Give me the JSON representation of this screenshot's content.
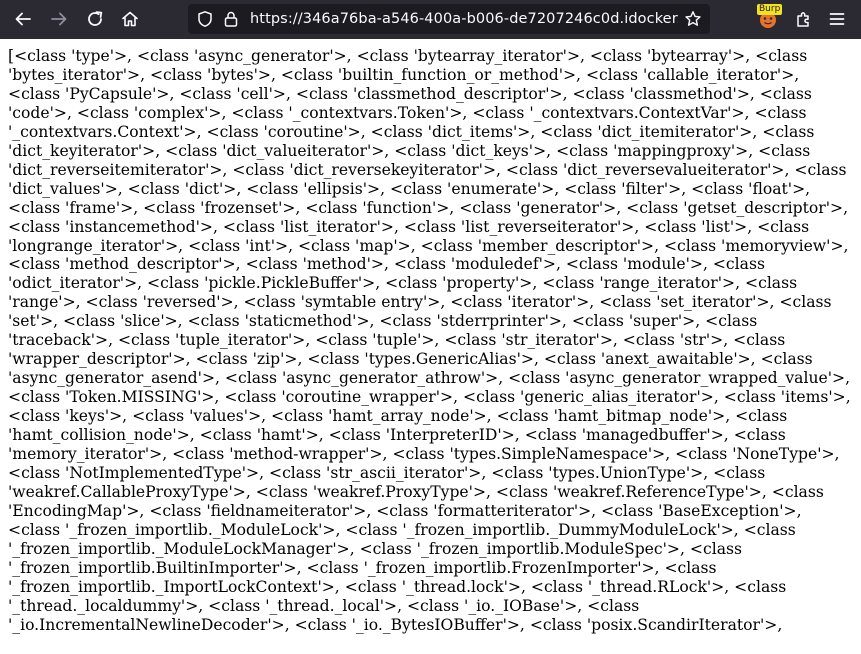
{
  "browser": {
    "url": "https://346a76ba-a546-400a-b006-de7207246c0d.idocker.vulnhub.cn",
    "extension_badge": "Burp"
  },
  "icons": {
    "back": "arrow-left-icon",
    "forward": "arrow-right-icon",
    "reload": "reload-icon",
    "home": "home-icon",
    "tracking_protection": "shield-icon",
    "connection": "lock-icon",
    "bookmark": "star-icon",
    "burp_extension": "burp-extension-icon",
    "extensions": "puzzle-icon",
    "menu": "hamburger-menu-icon"
  },
  "page": {
    "body_text": "[<class 'type'>, <class 'async_generator'>, <class 'bytearray_iterator'>, <class 'bytearray'>, <class 'bytes_iterator'>, <class 'bytes'>, <class 'builtin_function_or_method'>, <class 'callable_iterator'>, <class 'PyCapsule'>, <class 'cell'>, <class 'classmethod_descriptor'>, <class 'classmethod'>, <class 'code'>, <class 'complex'>, <class '_contextvars.Token'>, <class '_contextvars.ContextVar'>, <class '_contextvars.Context'>, <class 'coroutine'>, <class 'dict_items'>, <class 'dict_itemiterator'>, <class 'dict_keyiterator'>, <class 'dict_valueiterator'>, <class 'dict_keys'>, <class 'mappingproxy'>, <class 'dict_reverseitemiterator'>, <class 'dict_reversekeyiterator'>, <class 'dict_reversevalueiterator'>, <class 'dict_values'>, <class 'dict'>, <class 'ellipsis'>, <class 'enumerate'>, <class 'filter'>, <class 'float'>, <class 'frame'>, <class 'frozenset'>, <class 'function'>, <class 'generator'>, <class 'getset_descriptor'>, <class 'instancemethod'>, <class 'list_iterator'>, <class 'list_reverseiterator'>, <class 'list'>, <class 'longrange_iterator'>, <class 'int'>, <class 'map'>, <class 'member_descriptor'>, <class 'memoryview'>, <class 'method_descriptor'>, <class 'method'>, <class 'moduledef'>, <class 'module'>, <class 'odict_iterator'>, <class 'pickle.PickleBuffer'>, <class 'property'>, <class 'range_iterator'>, <class 'range'>, <class 'reversed'>, <class 'symtable entry'>, <class 'iterator'>, <class 'set_iterator'>, <class 'set'>, <class 'slice'>, <class 'staticmethod'>, <class 'stderrprinter'>, <class 'super'>, <class 'traceback'>, <class 'tuple_iterator'>, <class 'tuple'>, <class 'str_iterator'>, <class 'str'>, <class 'wrapper_descriptor'>, <class 'zip'>, <class 'types.GenericAlias'>, <class 'anext_awaitable'>, <class 'async_generator_asend'>, <class 'async_generator_athrow'>, <class 'async_generator_wrapped_value'>, <class 'Token.MISSING'>, <class 'coroutine_wrapper'>, <class 'generic_alias_iterator'>, <class 'items'>, <class 'keys'>, <class 'values'>, <class 'hamt_array_node'>, <class 'hamt_bitmap_node'>, <class 'hamt_collision_node'>, <class 'hamt'>, <class 'InterpreterID'>, <class 'managedbuffer'>, <class 'memory_iterator'>, <class 'method-wrapper'>, <class 'types.SimpleNamespace'>, <class 'NoneType'>, <class 'NotImplementedType'>, <class 'str_ascii_iterator'>, <class 'types.UnionType'>, <class 'weakref.CallableProxyType'>, <class 'weakref.ProxyType'>, <class 'weakref.ReferenceType'>, <class 'EncodingMap'>, <class 'fieldnameiterator'>, <class 'formatteriterator'>, <class 'BaseException'>, <class '_frozen_importlib._ModuleLock'>, <class '_frozen_importlib._DummyModuleLock'>, <class '_frozen_importlib._ModuleLockManager'>, <class '_frozen_importlib.ModuleSpec'>, <class '_frozen_importlib.BuiltinImporter'>, <class '_frozen_importlib.FrozenImporter'>, <class '_frozen_importlib._ImportLockContext'>, <class '_thread.lock'>, <class '_thread.RLock'>, <class '_thread._localdummy'>, <class '_thread._local'>, <class '_io._IOBase'>, <class '_io.IncrementalNewlineDecoder'>, <class '_io._BytesIOBuffer'>, <class 'posix.ScandirIterator'>,"
  },
  "colors": {
    "toolbar_bg": "#2b2a33",
    "urlbar_bg": "#1c1b22",
    "toolbar_icon": "#fbfbfe",
    "page_bg": "#ffffff",
    "page_text": "#000000"
  }
}
